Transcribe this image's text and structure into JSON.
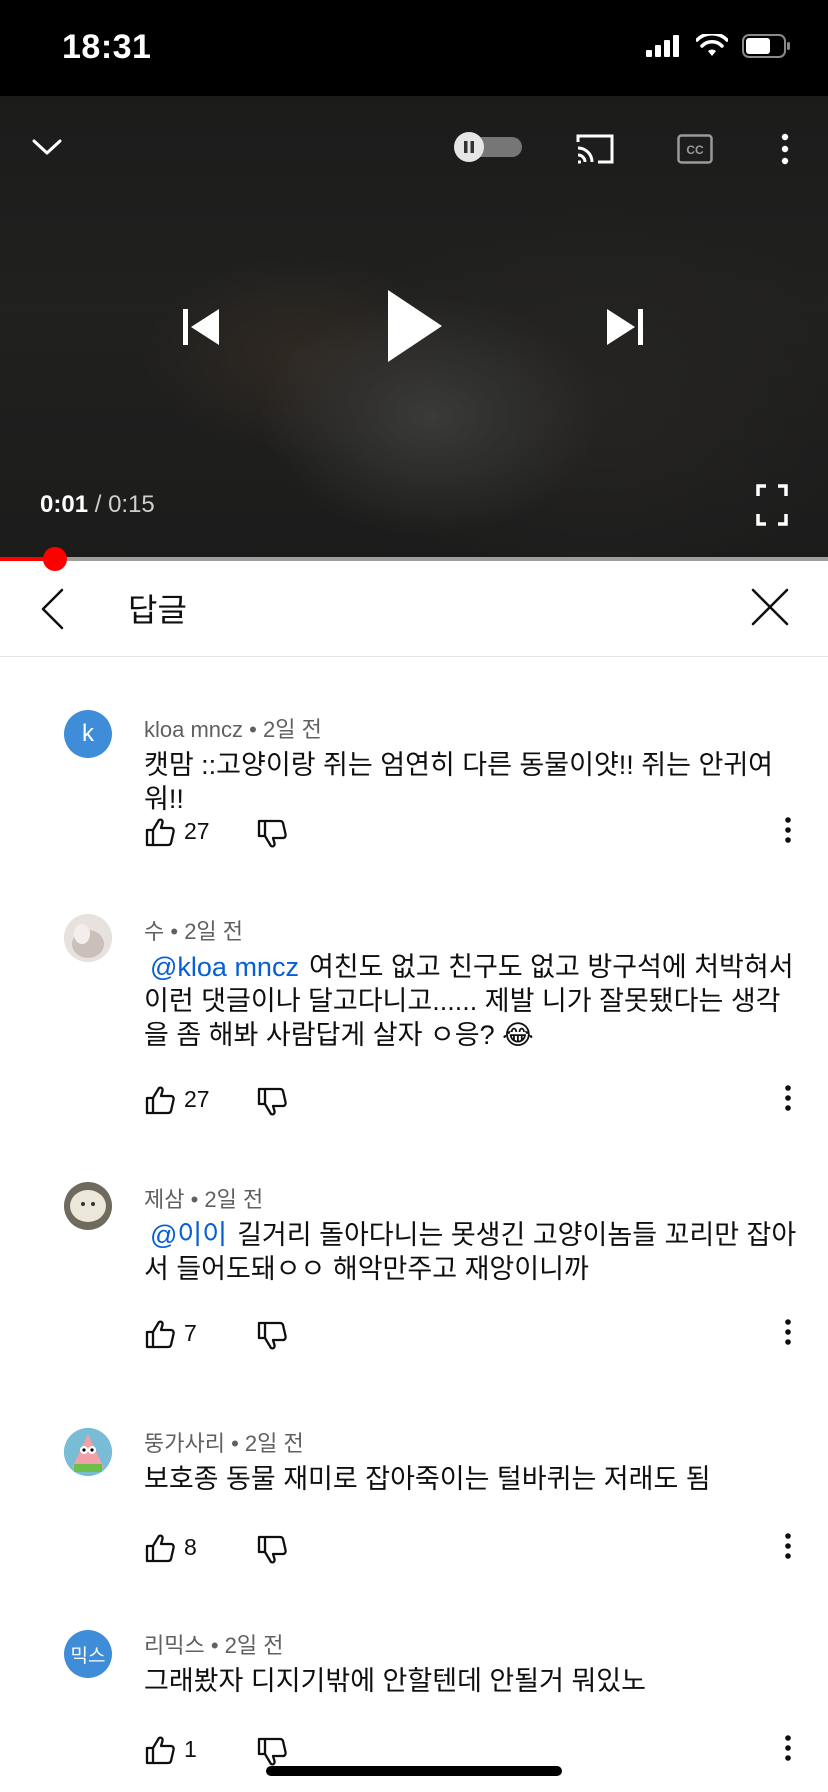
{
  "status_bar": {
    "time": "18:31"
  },
  "player": {
    "current_time": "0:01",
    "separator": " / ",
    "duration": "0:15",
    "progress_fraction": 0.067,
    "autoplay": "paused",
    "icons": [
      "chevron-down-icon",
      "autoplay-toggle",
      "cast-icon",
      "cc-icon",
      "more-vert-icon",
      "skip-previous-icon",
      "play-icon",
      "skip-next-icon",
      "fullscreen-icon"
    ]
  },
  "replies_panel": {
    "title": "답글"
  },
  "comments": [
    {
      "author": "kloa mncz",
      "time": "2일 전",
      "avatar_letter": "k",
      "avatar_color": "#3f8cd9",
      "mention": "",
      "text": "캣맘 ::고양이랑 쥐는 엄연히 다른 동물이얏!! 쥐는 안귀여워!!",
      "likes": "27"
    },
    {
      "author": "수",
      "time": "2일 전",
      "avatar_letter": "",
      "avatar_color": "#d8cfcb",
      "mention": "@kloa mncz",
      "text": "여친도 없고 친구도 없고 방구석에 처박혀서 이런 댓글이나 달고다니고...... 제발 니가 잘못됐다는 생각을 좀 해봐 사람답게 살자 ㅇ응? 😂",
      "likes": "27"
    },
    {
      "author": "제삼",
      "time": "2일 전",
      "avatar_letter": "",
      "avatar_color": "#cfc8b8",
      "mention": "@이이",
      "text": "길거리 돌아다니는 못생긴 고양이놈들 꼬리만 잡아서 들어도돼ㅇㅇ 해악만주고 재앙이니까",
      "likes": "7"
    },
    {
      "author": "뚱가사리",
      "time": "2일 전",
      "avatar_letter": "",
      "avatar_color": "#6fb0c9",
      "mention": "",
      "text": "보호종 동물 재미로 잡아죽이는 털바퀴는 저래도 됨",
      "likes": "8"
    },
    {
      "author": "리믹스",
      "time": "2일 전",
      "avatar_letter": "믹스",
      "avatar_color": "#3f8cd9",
      "mention": "",
      "text": "그래봤자 디지기밖에 안할텐데 안될거 뭐있노",
      "likes": "1"
    }
  ],
  "dot": " • "
}
